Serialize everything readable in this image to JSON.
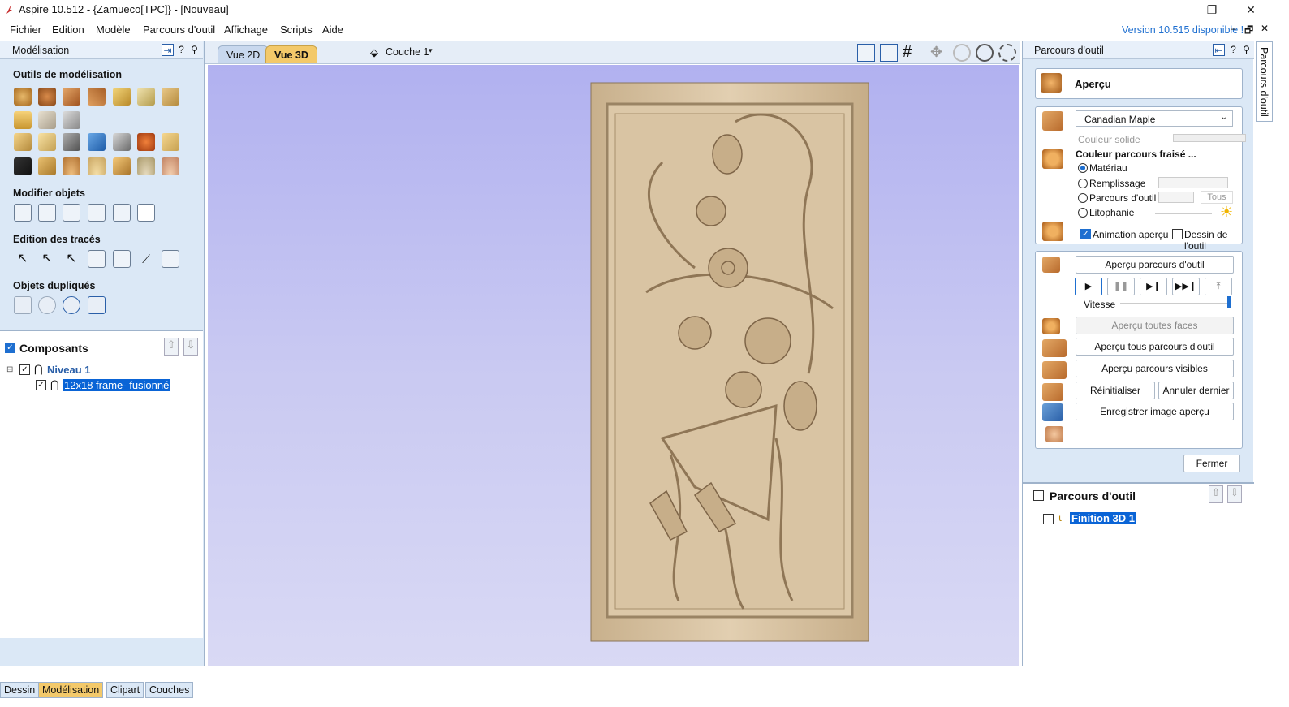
{
  "window": {
    "title": "Aspire 10.512 - {Zamueco[TPC]} - [Nouveau]",
    "minimize": "—",
    "maximize": "❐",
    "close": "✕"
  },
  "menu": {
    "items": [
      "Fichier",
      "Edition",
      "Modèle",
      "Parcours d'outil",
      "Affichage",
      "Scripts",
      "Aide"
    ],
    "version_notice": "Version 10.515 disponible !",
    "mdi_min": "–",
    "mdi_restore": "🗗",
    "mdi_close": "✕"
  },
  "left": {
    "title": "Modélisation",
    "sections": {
      "outils": "Outils de modélisation",
      "modifier": "Modifier objets",
      "edition": "Edition des tracés",
      "dupliques": "Objets dupliqués"
    },
    "components": {
      "title": "Composants",
      "level": "Niveau 1",
      "item": "12x18 frame- fusionné"
    },
    "tabs": [
      "Dessin",
      "Modélisation",
      "Clipart",
      "Couches"
    ]
  },
  "view": {
    "tab2d": "Vue 2D",
    "tab3d": "Vue 3D",
    "layer": "Couche 1"
  },
  "right": {
    "title": "Parcours d'outil",
    "side_tab": "Parcours d'outil",
    "preview_title": "Aperçu",
    "material": "Canadian Maple",
    "solid_color": "Couleur solide",
    "toolpath_color_title": "Couleur parcours fraisé ...",
    "radio": {
      "materiau": "Matériau",
      "remplissage": "Remplissage",
      "parcours": "Parcours d'outil",
      "litho": "Litophanie"
    },
    "all": "Tous",
    "anim": "Animation aperçu",
    "draw_tool": "Dessin de l'outil",
    "preview_toolpath": "Aperçu parcours d'outil",
    "speed": "Vitesse",
    "all_faces": "Aperçu toutes faces",
    "all_toolpaths": "Aperçu tous parcours d'outil",
    "visible_toolpaths": "Aperçu parcours visibles",
    "reset": "Réinitialiser aperçu",
    "undo_last": "Annuler dernier",
    "save_image": "Enregistrer image aperçu",
    "close": "Fermer",
    "toolpaths_title": "Parcours d'outil",
    "toolpath_item": "Finition 3D 1"
  },
  "colors": {
    "panel_bg": "#dbe8f6",
    "viewport_top": "#b1b1f0",
    "accent_tab": "#f3c96a",
    "selection": "#0a64d6",
    "wood": "#d8c2a1"
  }
}
